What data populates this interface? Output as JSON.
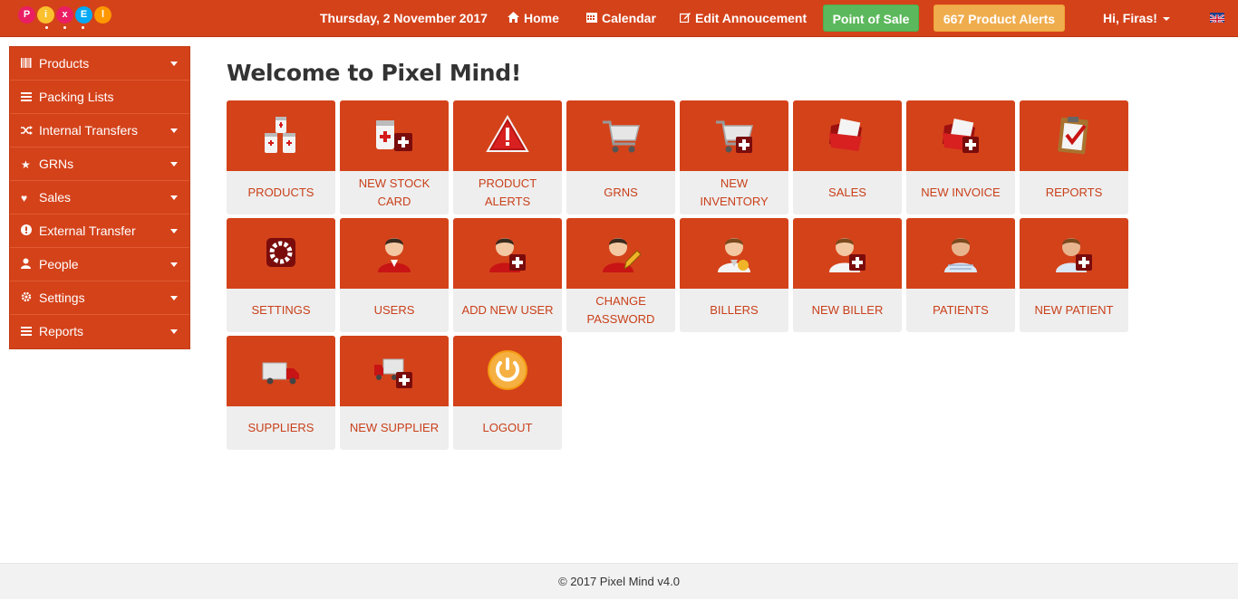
{
  "header": {
    "date": "Thursday, 2 November 2017",
    "home_label": "Home",
    "calendar_label": "Calendar",
    "edit_announcement_label": "Edit Annoucement",
    "pos_label": "Point of Sale",
    "alerts_label": "667 Product Alerts",
    "user_label": "Hi, Firas!",
    "logo_letters": [
      "P",
      "i",
      "x",
      "E",
      "l"
    ],
    "colors": {
      "bar": "#d4421a",
      "pos": "#5cb85c",
      "alerts": "#f0ad4e"
    }
  },
  "sidebar": {
    "items": [
      {
        "label": "Products",
        "icon": "barcode-icon",
        "dropdown": true
      },
      {
        "label": "Packing Lists",
        "icon": "list-icon",
        "dropdown": false
      },
      {
        "label": "Internal Transfers",
        "icon": "shuffle-icon",
        "dropdown": true
      },
      {
        "label": "GRNs",
        "icon": "star-icon",
        "dropdown": true
      },
      {
        "label": "Sales",
        "icon": "heart-icon",
        "dropdown": true
      },
      {
        "label": "External Transfer",
        "icon": "exclamation-icon",
        "dropdown": true
      },
      {
        "label": "People",
        "icon": "user-icon",
        "dropdown": true
      },
      {
        "label": "Settings",
        "icon": "gear-icon",
        "dropdown": true
      },
      {
        "label": "Reports",
        "icon": "list-icon",
        "dropdown": true
      }
    ]
  },
  "main": {
    "title": "Welcome to Pixel Mind!",
    "tiles": [
      {
        "label": "PRODUCTS",
        "icon": "medicine-bottles-icon"
      },
      {
        "label": "NEW STOCK CARD",
        "icon": "medicine-add-icon"
      },
      {
        "label": "PRODUCT ALERTS",
        "icon": "warning-icon"
      },
      {
        "label": "GRNS",
        "icon": "cart-icon"
      },
      {
        "label": "NEW INVENTORY",
        "icon": "cart-add-icon"
      },
      {
        "label": "SALES",
        "icon": "folder-icon"
      },
      {
        "label": "NEW INVOICE",
        "icon": "folder-add-icon"
      },
      {
        "label": "REPORTS",
        "icon": "clipboard-icon"
      },
      {
        "label": "SETTINGS",
        "icon": "gear-icon"
      },
      {
        "label": "USERS",
        "icon": "user-icon"
      },
      {
        "label": "ADD NEW USER",
        "icon": "user-add-icon"
      },
      {
        "label": "CHANGE PASSWORD",
        "icon": "user-edit-icon"
      },
      {
        "label": "BILLERS",
        "icon": "biller-icon"
      },
      {
        "label": "NEW BILLER",
        "icon": "biller-add-icon"
      },
      {
        "label": "PATIENTS",
        "icon": "patient-icon"
      },
      {
        "label": "NEW PATIENT",
        "icon": "patient-add-icon"
      },
      {
        "label": "SUPPLIERS",
        "icon": "truck-icon"
      },
      {
        "label": "NEW SUPPLIER",
        "icon": "truck-add-icon"
      },
      {
        "label": "LOGOUT",
        "icon": "power-icon"
      }
    ]
  },
  "footer": {
    "text": "© 2017 Pixel Mind v4.0"
  }
}
